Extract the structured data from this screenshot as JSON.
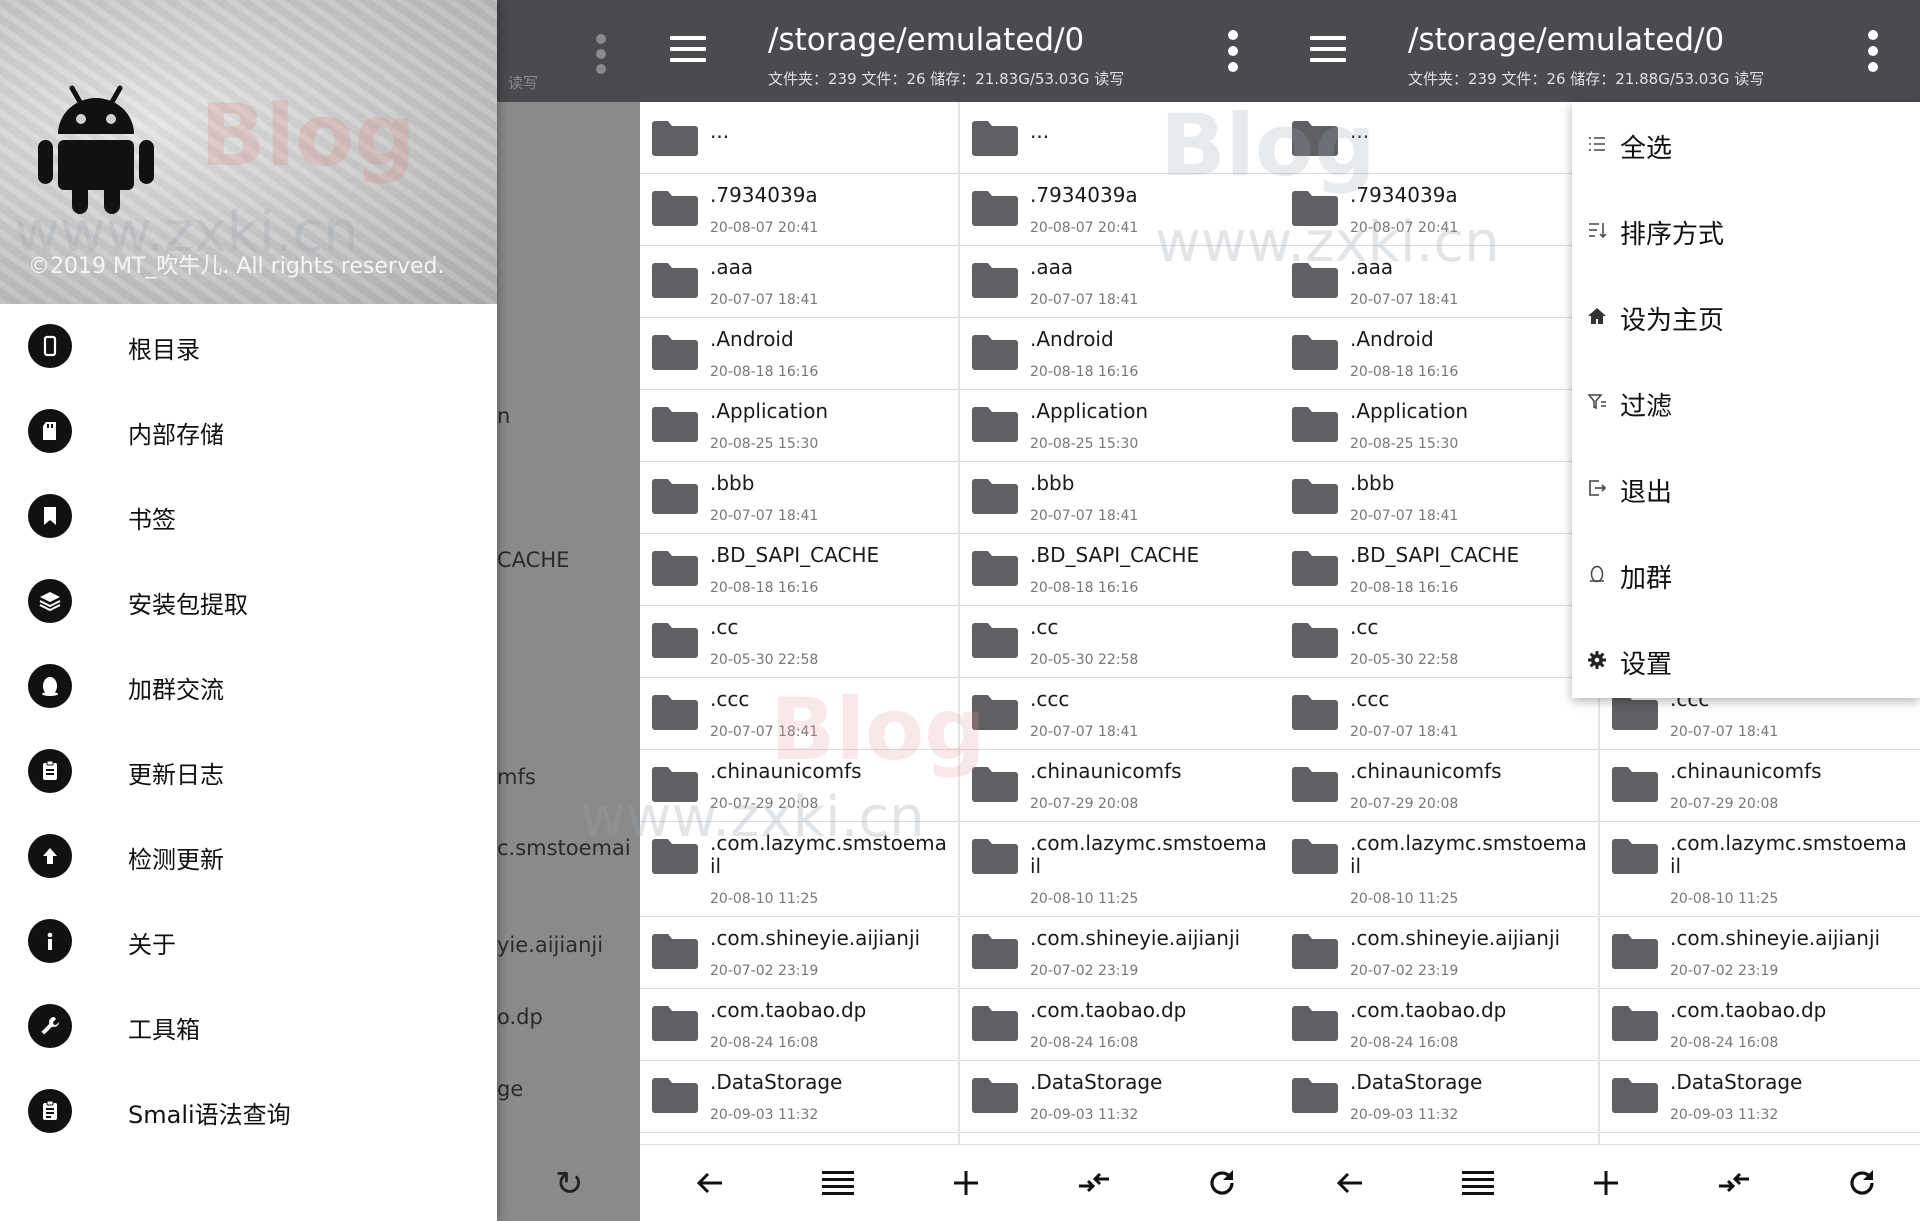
{
  "drawer": {
    "copyright": "©2019 MT_吹牛儿. All rights reserved.",
    "watermark_blog": "Blog",
    "watermark_url": "www.zxki.cn",
    "items": [
      {
        "label": "根目录",
        "icon": "phone-icon"
      },
      {
        "label": "内部存储",
        "icon": "sd-card-icon"
      },
      {
        "label": "书签",
        "icon": "bookmark-icon"
      },
      {
        "label": "安装包提取",
        "icon": "layers-icon"
      },
      {
        "label": "加群交流",
        "icon": "penguin-icon"
      },
      {
        "label": "更新日志",
        "icon": "clipboard-icon"
      },
      {
        "label": "检测更新",
        "icon": "arrow-up-icon"
      },
      {
        "label": "关于",
        "icon": "info-icon"
      },
      {
        "label": "工具箱",
        "icon": "wrench-icon"
      },
      {
        "label": "Smali语法查询",
        "icon": "clipboard-list-icon"
      }
    ]
  },
  "underlay": {
    "rw_label": "读写",
    "rows": [
      "n",
      "CACHE",
      "mfs",
      "c.smstoemai",
      "yie.aijianji",
      "o.dp",
      "ge"
    ]
  },
  "panel_a": {
    "path": "/storage/emulated/0",
    "info": "文件夹：239 文件：26  储存：21.83G/53.03G   读写"
  },
  "panel_b": {
    "path": "/storage/emulated/0",
    "info": "文件夹：239 文件：26  储存：21.88G/53.03G   读写"
  },
  "files": [
    {
      "name": "...",
      "date": ""
    },
    {
      "name": ".7934039a",
      "date": "20-08-07 20:41"
    },
    {
      "name": ".aaa",
      "date": "20-07-07 18:41"
    },
    {
      "name": ".Android",
      "date": "20-08-18 16:16"
    },
    {
      "name": ".Application",
      "date": "20-08-25 15:30"
    },
    {
      "name": ".bbb",
      "date": "20-07-07 18:41"
    },
    {
      "name": ".BD_SAPI_CACHE",
      "date": "20-08-18 16:16"
    },
    {
      "name": ".cc",
      "date": "20-05-30 22:58"
    },
    {
      "name": ".ccc",
      "date": "20-07-07 18:41"
    },
    {
      "name": ".chinaunicomfs",
      "date": "20-07-29 20:08"
    },
    {
      "name": ".com.lazymc.smstoemail",
      "date": "20-08-10 11:25"
    },
    {
      "name": ".com.shineyie.aijianji",
      "date": "20-07-02 23:19"
    },
    {
      "name": ".com.taobao.dp",
      "date": "20-08-24 16:08"
    },
    {
      "name": ".DataStorage",
      "date": "20-09-03 11:32"
    }
  ],
  "menu": [
    {
      "label": "全选",
      "icon": "select-all-icon"
    },
    {
      "label": "排序方式",
      "icon": "sort-icon"
    },
    {
      "label": "设为主页",
      "icon": "home-icon"
    },
    {
      "label": "过滤",
      "icon": "filter-icon"
    },
    {
      "label": "退出",
      "icon": "exit-icon"
    },
    {
      "label": "加群",
      "icon": "penguin-icon"
    },
    {
      "label": "设置",
      "icon": "gear-icon"
    }
  ],
  "bottom_bar": [
    "back-arrow-icon",
    "list-icon",
    "add-icon",
    "swap-icon",
    "refresh-icon"
  ],
  "colors": {
    "toolbar": "#4a4b4f",
    "underlay": "#8a8a8a",
    "folder": "#5f6063"
  }
}
